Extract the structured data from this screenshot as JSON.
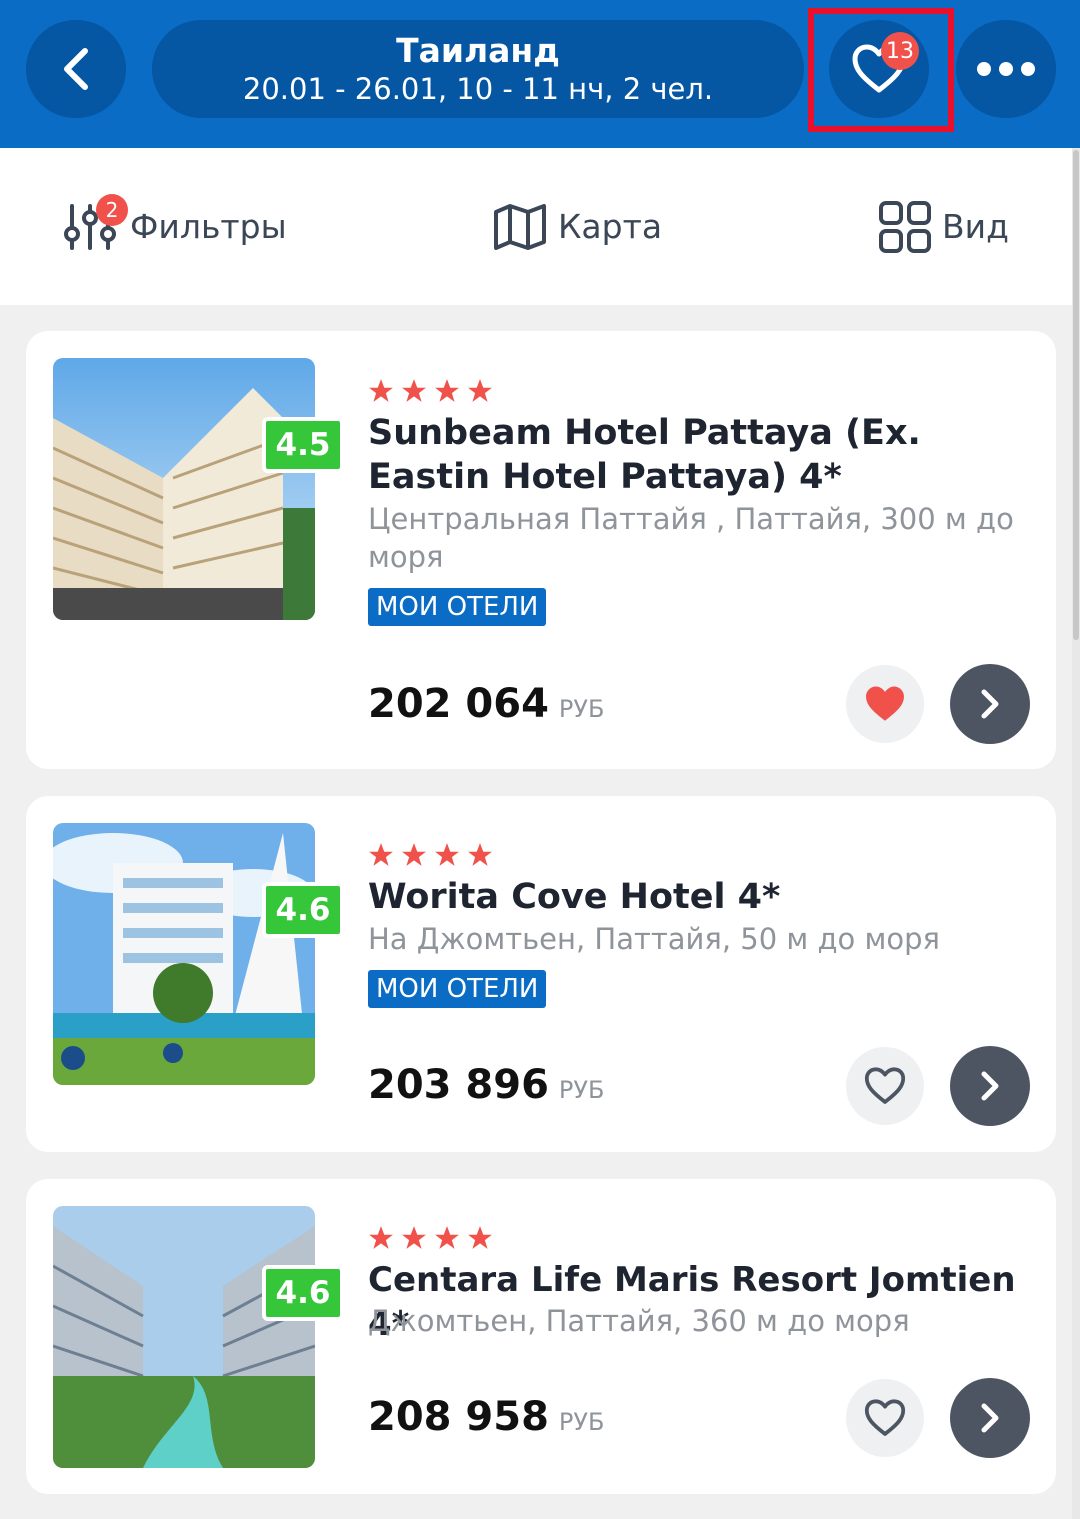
{
  "header": {
    "title": "Таиланд",
    "subtitle": "20.01 - 26.01, 10 - 11 нч, 2 чел.",
    "favorites_count": "13",
    "back_icon": "chevron-left-icon",
    "favorites_icon": "heart-outline-icon",
    "more_icon": "more-dots-icon"
  },
  "toolbar": {
    "filters_label": "Фильтры",
    "filters_badge": "2",
    "map_label": "Карта",
    "view_label": "Вид"
  },
  "hotels": [
    {
      "rating": "4.5",
      "stars": 4,
      "name": "Sunbeam Hotel Pattaya (Ex. Eastin Hotel Pattaya) 4*",
      "location": "Центральная Паттайя , Паттайя, 300 м до моря",
      "tag": "МОИ ОТЕЛИ",
      "price": "202 064",
      "currency": "РУБ",
      "favorited": true
    },
    {
      "rating": "4.6",
      "stars": 4,
      "name": "Worita Cove Hotel 4*",
      "location": "На Джомтьен, Паттайя, 50 м до моря",
      "tag": "МОИ ОТЕЛИ",
      "price": "203 896",
      "currency": "РУБ",
      "favorited": false
    },
    {
      "rating": "4.6",
      "stars": 4,
      "name": "Centara Life Maris Resort Jomtien 4*",
      "location": "Джомтьен, Паттайя, 360 м до моря",
      "tag": "",
      "price": "208 958",
      "currency": "РУБ",
      "favorited": false
    }
  ],
  "colors": {
    "header_blue": "#0a6cc4",
    "pill_blue": "#0556a3",
    "rating_green": "#35c63a",
    "star_red": "#f0524b",
    "highlight_red": "#e8102a"
  }
}
